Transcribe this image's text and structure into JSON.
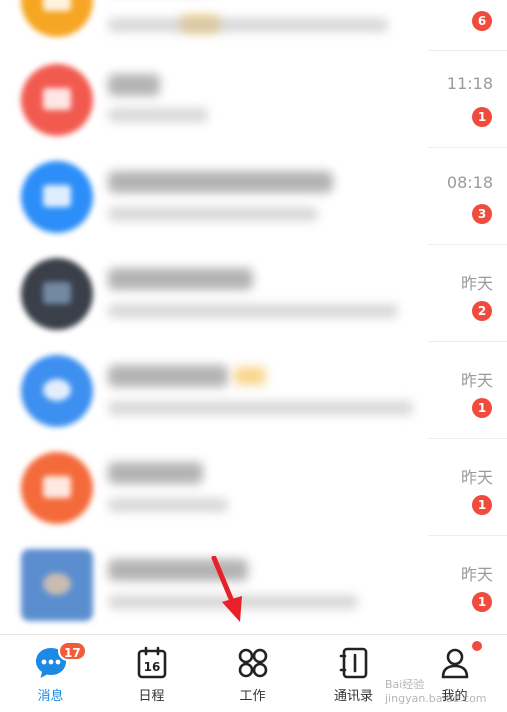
{
  "conversations": [
    {
      "time": "",
      "badge": "6",
      "avatar_color": "#f6a623"
    },
    {
      "time": "11:18",
      "badge": "1",
      "avatar_color": "#f25a50"
    },
    {
      "time": "08:18",
      "badge": "3",
      "avatar_color": "#2c8ef8"
    },
    {
      "time": "昨天",
      "badge": "2",
      "avatar_color": "#3a3f4a"
    },
    {
      "time": "昨天",
      "badge": "1",
      "avatar_color": "#3d8ff0"
    },
    {
      "time": "昨天",
      "badge": "1",
      "avatar_color": "#f46a3a"
    },
    {
      "time": "昨天",
      "badge": "1",
      "avatar_color": "#5b8ecf"
    }
  ],
  "tabbar": {
    "tabs": [
      {
        "label": "消息",
        "badge": "17",
        "icon": "chat-bubble-icon"
      },
      {
        "label": "日程",
        "day": "16",
        "icon": "calendar-icon"
      },
      {
        "label": "工作",
        "icon": "grid-icon"
      },
      {
        "label": "通讯录",
        "icon": "contacts-book-icon"
      },
      {
        "label": "我的",
        "icon": "person-icon"
      }
    ]
  },
  "watermark": "Bai经验 jingyan.baidu.com",
  "colors": {
    "accent": "#1e88e5",
    "badge": "#f04b3c",
    "arrow": "#e8202a"
  }
}
